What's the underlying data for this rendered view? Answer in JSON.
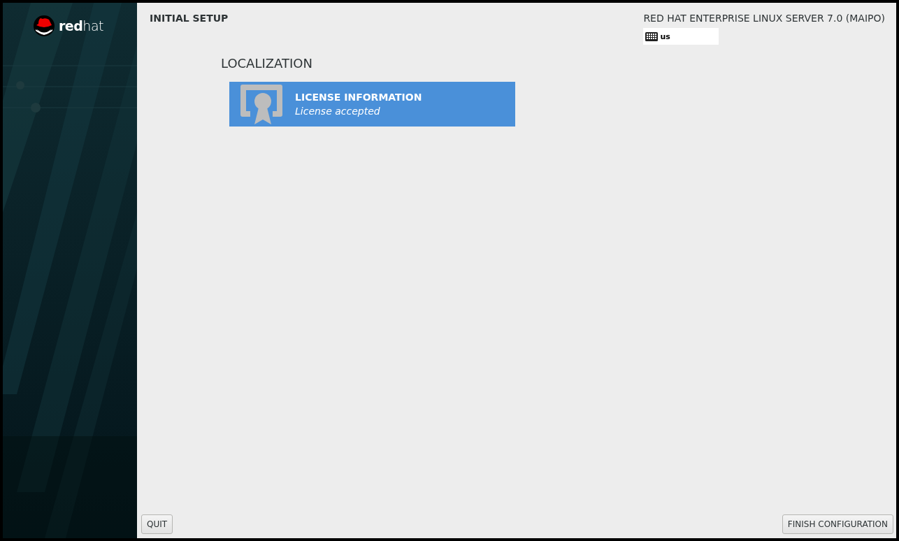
{
  "sidebar": {
    "logo": "**red**hat"
  },
  "header": {
    "title": "INITIAL SETUP",
    "product": "RED HAT ENTERPRISE LINUX SERVER 7.0 (MAIPO)",
    "keyboard_layout": "us"
  },
  "sections": [
    {
      "title": "LOCALIZATION",
      "spokes": [
        {
          "title": "LICENSE INFORMATION",
          "status": "License accepted",
          "selected": true
        }
      ]
    }
  ],
  "buttons": {
    "quit": "QUIT",
    "finish": "FINISH CONFIGURATION"
  }
}
